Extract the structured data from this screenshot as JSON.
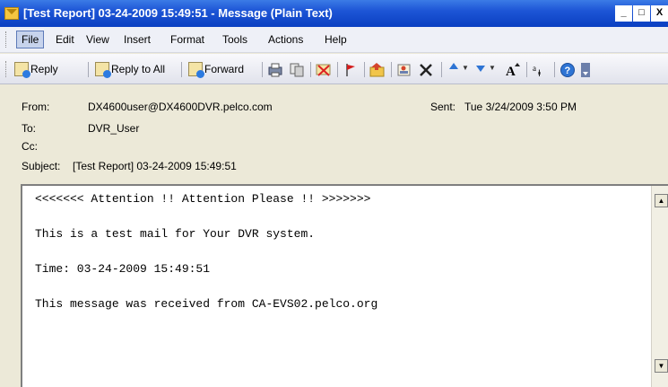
{
  "window": {
    "title": "[Test Report] 03-24-2009 15:49:51 - Message (Plain Text)",
    "controls": {
      "minimize": "_",
      "restore": "□",
      "close": "X"
    }
  },
  "menu": [
    "File",
    "Edit",
    "View",
    "Insert",
    "Format",
    "Tools",
    "Actions",
    "Help"
  ],
  "toolbar": {
    "reply": "Reply",
    "reply_all": "Reply to All",
    "forward": "Forward",
    "icons": [
      "print-icon",
      "copy-icon",
      "mark-unread-icon",
      "flag-icon",
      "move-to-folder-icon",
      "contacts-icon",
      "delete-icon",
      "previous-item-icon",
      "next-item-icon",
      "font-size-icon",
      "encoding-icon",
      "help-icon"
    ]
  },
  "header": {
    "from_label": "From:",
    "from": "DX4600user@DX4600DVR.pelco.com",
    "sent_label": "Sent:",
    "sent": "Tue 3/24/2009 3:50 PM",
    "to_label": "To:",
    "to": "DVR_User",
    "cc_label": "Cc:",
    "cc": "",
    "subject_label": "Subject:",
    "subject": "[Test Report] 03-24-2009 15:49:51"
  },
  "body": {
    "lines": [
      "<<<<<<< Attention !! Attention Please !! >>>>>>>",
      "This is a test mail for Your DVR system.",
      "Time: 03-24-2009 15:49:51",
      "This message was received from CA-EVS02.pelco.org"
    ]
  },
  "colors": {
    "titlebar": "#0b3fc1",
    "chrome": "#ece9d8",
    "menu_selected": "#c7d3ec"
  }
}
